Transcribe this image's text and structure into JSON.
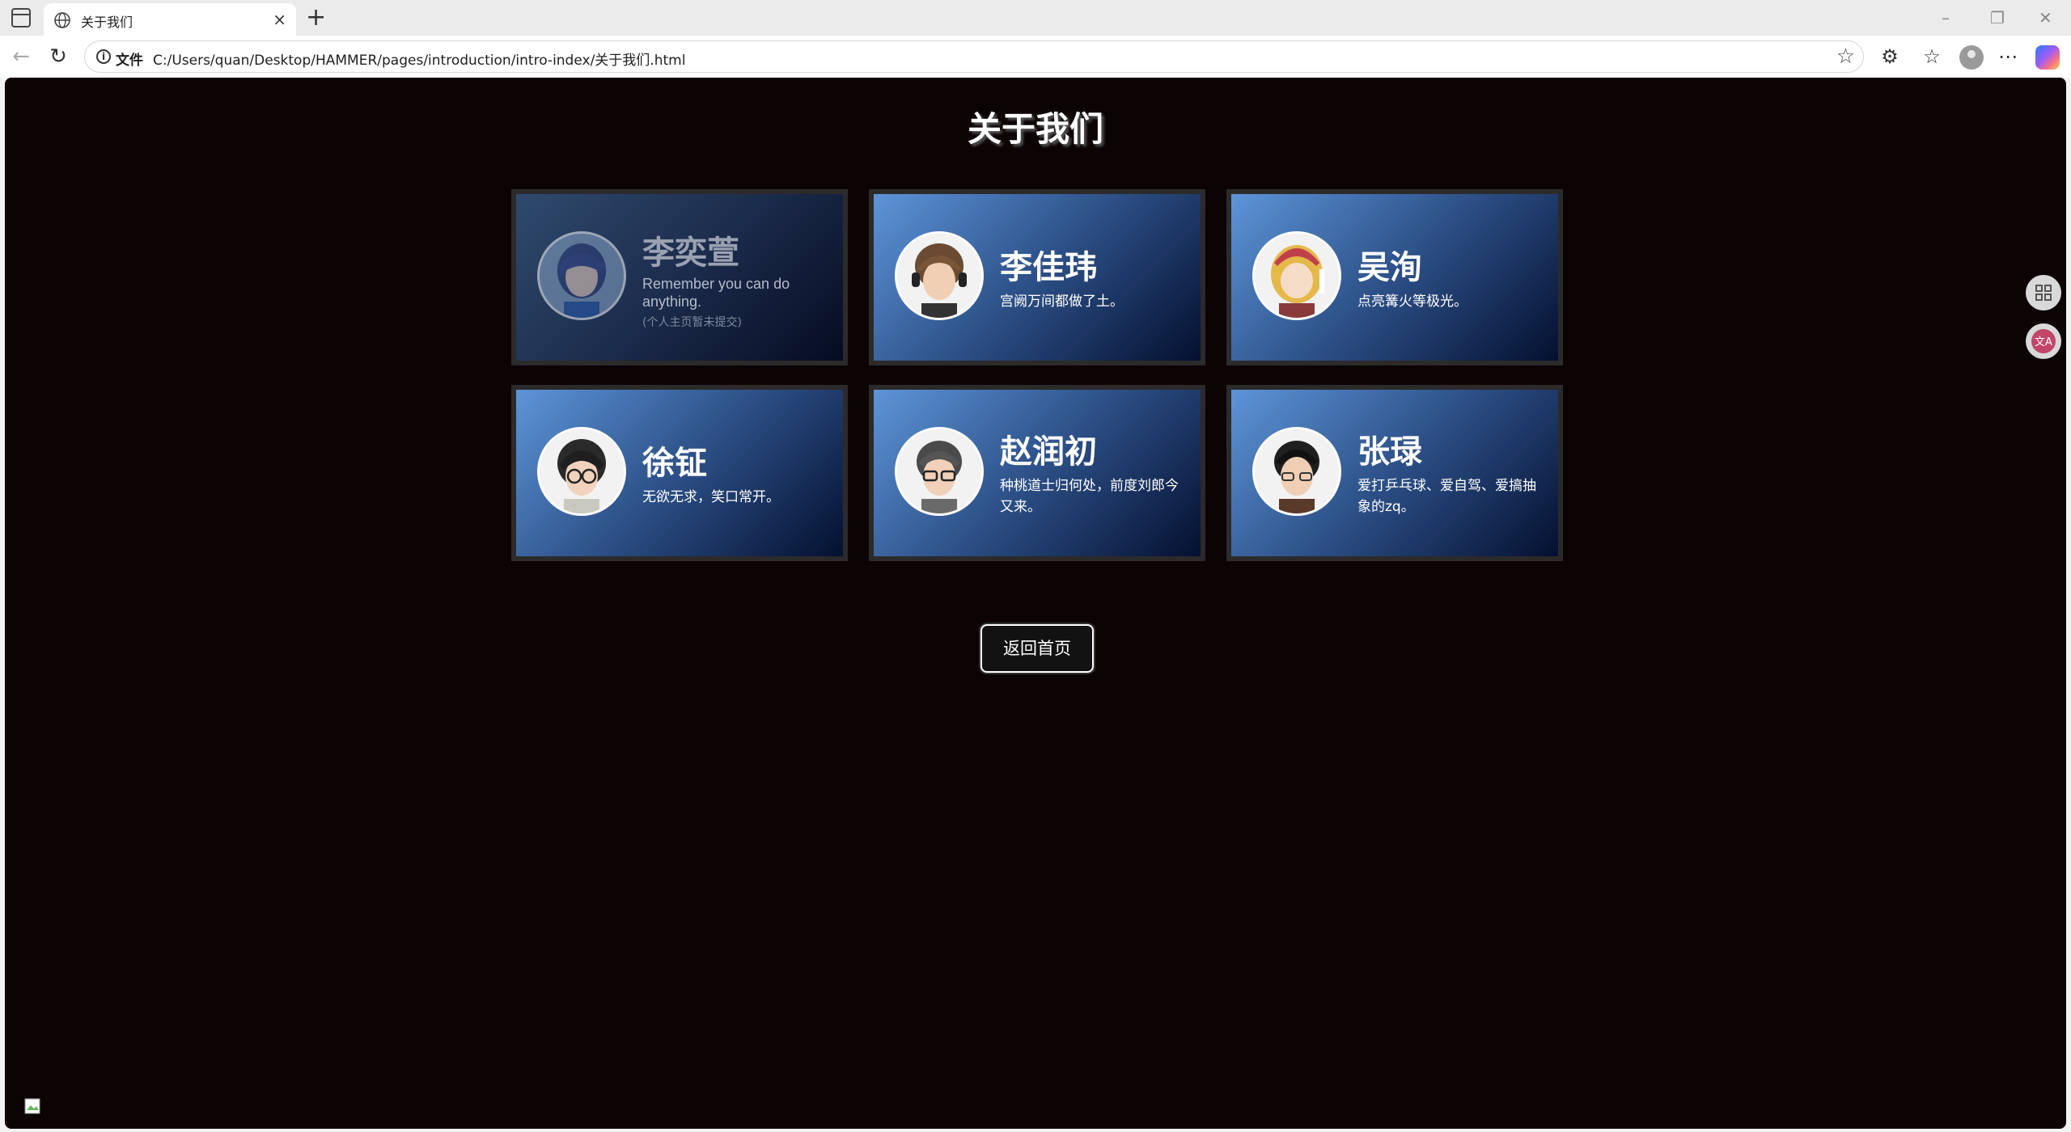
{
  "browser": {
    "tab_title": "关于我们",
    "address_scheme": "文件",
    "address_url": "C:/Users/quan/Desktop/HAMMER/pages/introduction/intro-index/关于我们.html",
    "icons": [
      "sidebar-icon",
      "globe-icon",
      "close-icon",
      "plus-icon",
      "minimize-icon",
      "restore-icon",
      "close-window-icon",
      "back-icon",
      "refresh-icon",
      "info-icon",
      "star-icon",
      "extensions-icon",
      "favorites-icon",
      "profile-icon",
      "more-icon",
      "copilot-icon"
    ]
  },
  "page": {
    "title": "关于我们",
    "members": [
      {
        "name": "李奕萱",
        "desc": "Remember you can do anything.",
        "note": "(个人主页暂未提交)",
        "dimmed": true
      },
      {
        "name": "李佳玮",
        "desc": "宫阙万间都做了土。"
      },
      {
        "name": "吴洵",
        "desc": "点亮篝火等极光。"
      },
      {
        "name": "徐钲",
        "desc": "无欲无求，笑口常开。"
      },
      {
        "name": "赵润初",
        "desc": "种桃道士归何处，前度刘郎今又来。"
      },
      {
        "name": "张琭",
        "desc": "爱打乒乓球、爱自驾、爱搞抽象的zq。"
      }
    ],
    "home_button": "返回首页"
  },
  "colors": {
    "page_bg": "#0b0304",
    "card_gradient_start": "#5d95d8",
    "card_gradient_end": "#041030",
    "card_frame": "#2c2a2a"
  }
}
